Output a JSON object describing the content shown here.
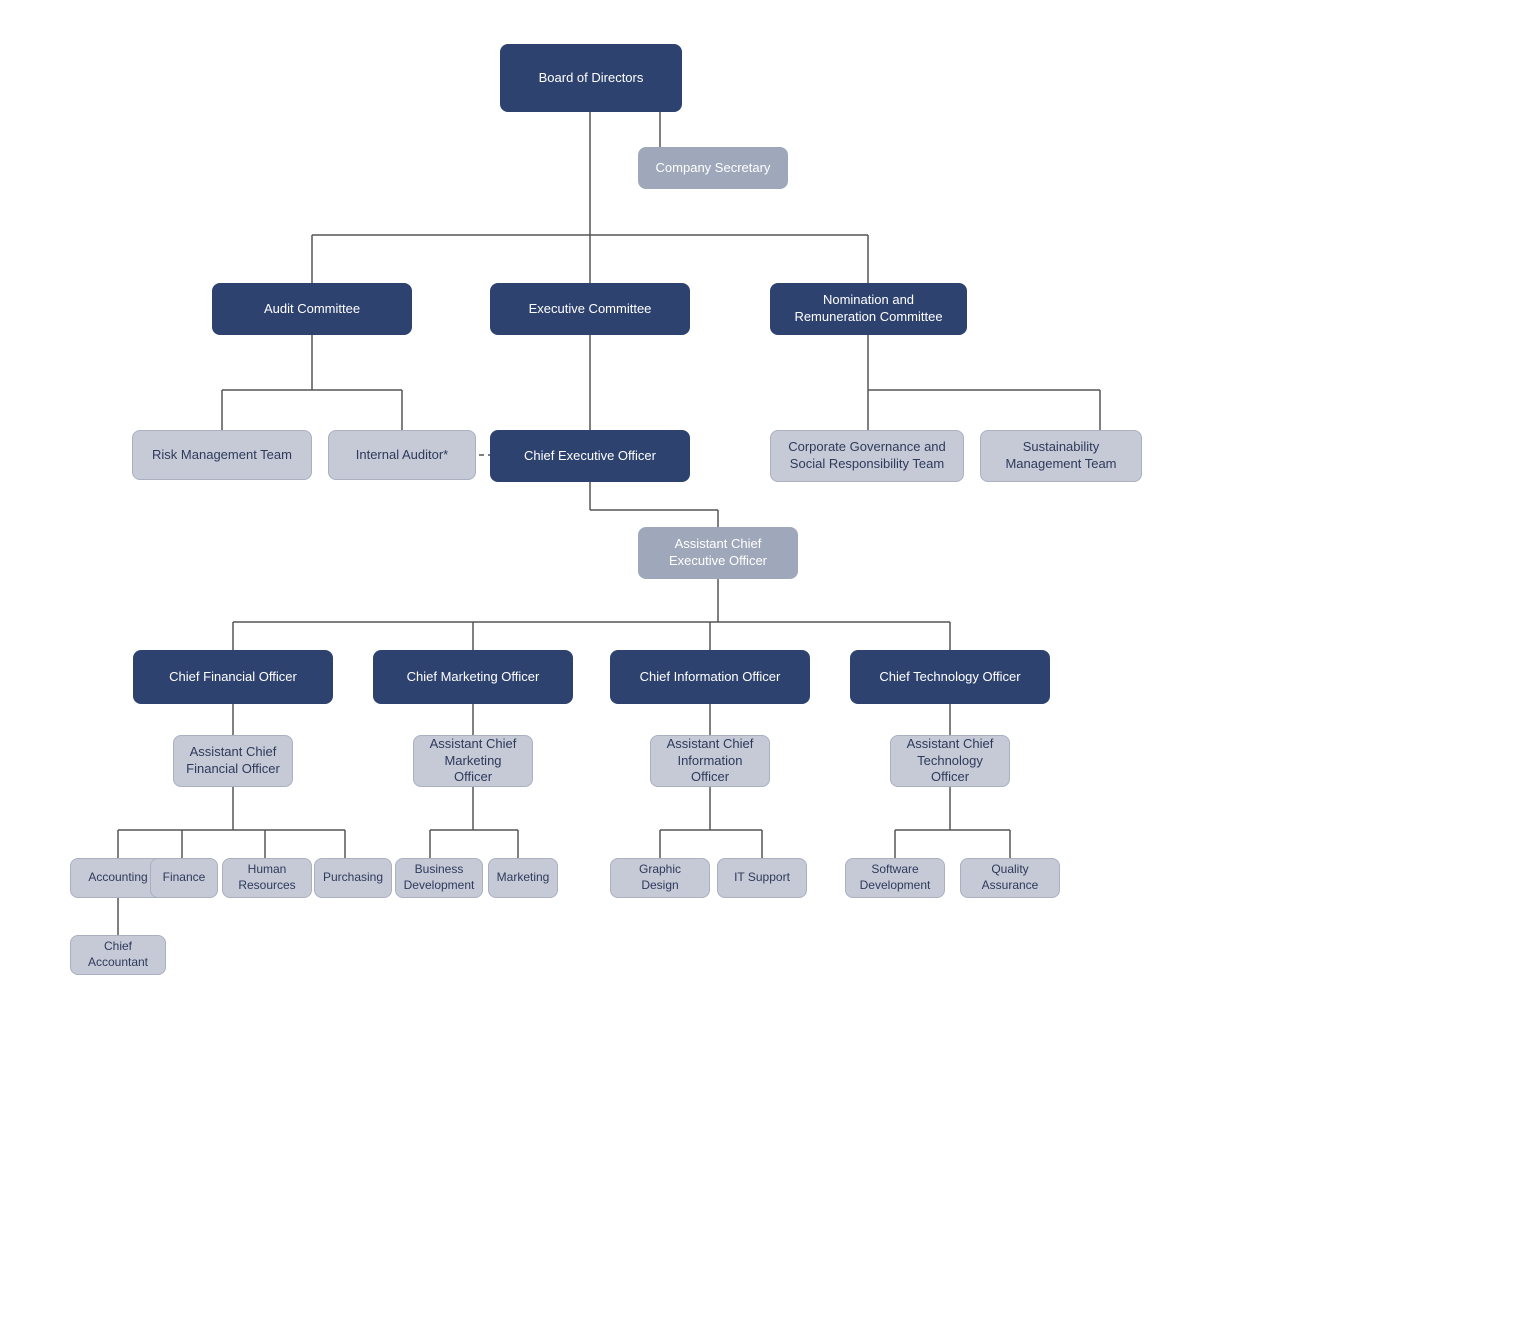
{
  "nodes": {
    "board": {
      "label": "Board of Directors"
    },
    "company_secretary": {
      "label": "Company Secretary"
    },
    "audit_committee": {
      "label": "Audit Committee"
    },
    "executive_committee": {
      "label": "Executive Committee"
    },
    "nomination_committee": {
      "label": "Nomination and\nRemuneration Committee"
    },
    "risk_management": {
      "label": "Risk Management Team"
    },
    "internal_auditor": {
      "label": "Internal Auditor*"
    },
    "ceo": {
      "label": "Chief Executive Officer"
    },
    "corp_governance": {
      "label": "Corporate Governance and\nSocial Responsibility Team"
    },
    "sustainability": {
      "label": "Sustainability\nManagement Team"
    },
    "asst_ceo": {
      "label": "Assistant Chief\nExecutive Officer"
    },
    "cfo": {
      "label": "Chief Financial Officer"
    },
    "cmo": {
      "label": "Chief Marketing Officer"
    },
    "cio": {
      "label": "Chief Information Officer"
    },
    "cto": {
      "label": "Chief Technology Officer"
    },
    "asst_cfo": {
      "label": "Assistant Chief\nFinancial Officer"
    },
    "asst_cmo": {
      "label": "Assistant Chief\nMarketing Officer"
    },
    "asst_cio": {
      "label": "Assistant Chief\nInformation Officer"
    },
    "asst_cto": {
      "label": "Assistant Chief\nTechnology Officer"
    },
    "accounting": {
      "label": "Accounting"
    },
    "finance": {
      "label": "Finance"
    },
    "hr": {
      "label": "Human Resources"
    },
    "purchasing": {
      "label": "Purchasing"
    },
    "biz_dev": {
      "label": "Business\nDevelopment"
    },
    "marketing": {
      "label": "Marketing"
    },
    "graphic_design": {
      "label": "Graphic Design"
    },
    "it_support": {
      "label": "IT Support"
    },
    "software_dev": {
      "label": "Software\nDevelopment"
    },
    "quality_assurance": {
      "label": "Quality Assurance"
    },
    "chief_accountant": {
      "label": "Chief\nAccountant"
    }
  }
}
